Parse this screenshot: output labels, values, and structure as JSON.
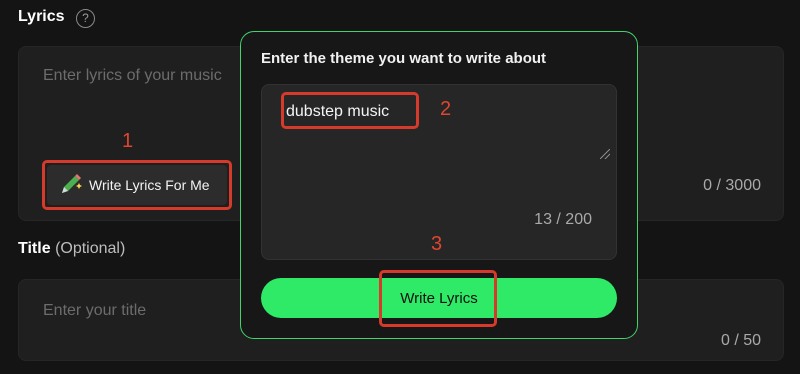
{
  "lyrics_section": {
    "label": "Lyrics",
    "help_glyph": "?",
    "placeholder": "Enter lyrics of your music",
    "write_button_label": "Write Lyrics For Me",
    "counter": "0 / 3000"
  },
  "title_section": {
    "label": "Title",
    "optional": "(Optional)",
    "placeholder": "Enter your title",
    "counter": "0 / 50"
  },
  "modal": {
    "title": "Enter the theme you want to write about",
    "theme_value": "dubstep music",
    "counter": "13 / 200",
    "submit_label": "Write Lyrics"
  },
  "annotations": [
    "1",
    "2",
    "3"
  ],
  "colors": {
    "accent_green": "#2eea66",
    "annotation_red": "#d63a2a",
    "background": "#141414"
  },
  "icons": {
    "write_button_icon": "magic-pen-icon",
    "help_icon": "question-circle-icon"
  }
}
